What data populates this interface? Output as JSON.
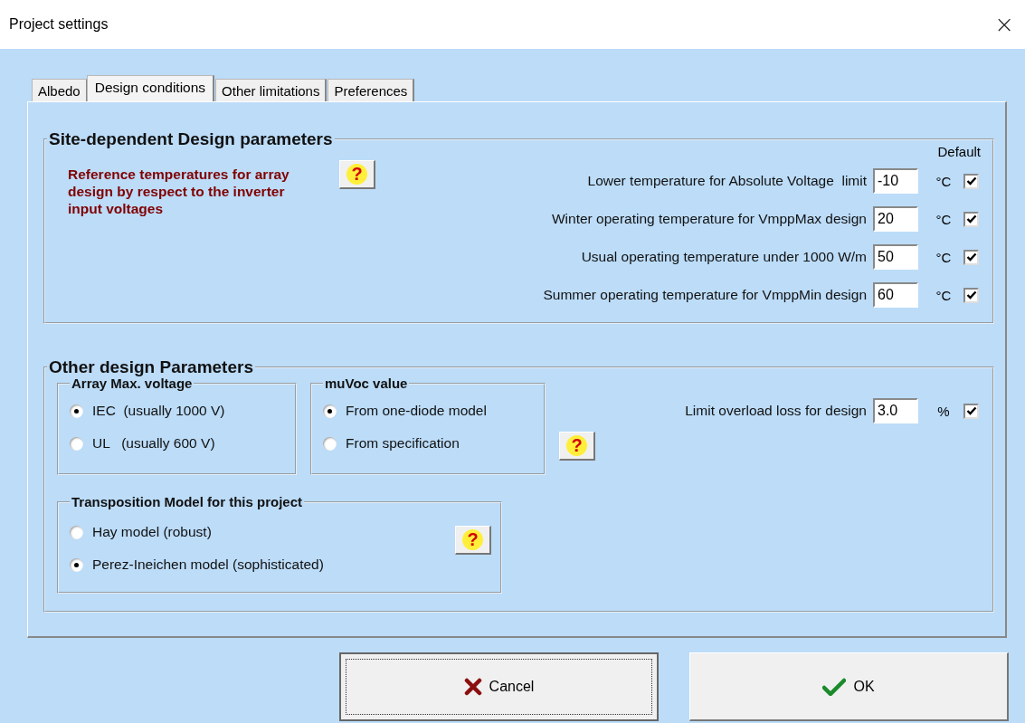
{
  "window": {
    "title": "Project settings",
    "close": "×"
  },
  "tabs": [
    {
      "label": "Albedo",
      "selected": false
    },
    {
      "label": "Design conditions",
      "selected": true
    },
    {
      "label": "Other limitations",
      "selected": false
    },
    {
      "label": "Preferences",
      "selected": false
    }
  ],
  "site_parameters": {
    "title": "Site-dependent Design parameters",
    "description": "Reference temperatures for array design by respect to the inverter input voltages",
    "help": "?",
    "default_label": "Default",
    "rows": [
      {
        "label": "Lower temperature for Absolute Voltage  limit",
        "value": "-10",
        "unit": "°C",
        "checked": true
      },
      {
        "label": "Winter operating temperature for VmppMax design",
        "value": "20",
        "unit": "°C",
        "checked": true
      },
      {
        "label": "Usual operating temperature under 1000 W/m",
        "value": "50",
        "unit": "°C",
        "checked": true
      },
      {
        "label": "Summer operating temperature for VmppMin design",
        "value": "60",
        "unit": "°C",
        "checked": true
      }
    ]
  },
  "other_parameters": {
    "title": "Other design Parameters",
    "array_voltage": {
      "title": "Array Max. voltage",
      "options": [
        {
          "label": "IEC  (usually 1000 V)",
          "selected": true
        },
        {
          "label": "UL   (usually 600 V)",
          "selected": false
        }
      ]
    },
    "muvoc": {
      "title": "muVoc value",
      "help": "?",
      "options": [
        {
          "label": "From one-diode model",
          "selected": true
        },
        {
          "label": "From specification",
          "selected": false
        }
      ]
    },
    "limit": {
      "label": "Limit overload loss for design",
      "value": "3.0",
      "unit": "%",
      "checked": true
    },
    "transposition": {
      "title": "Transposition Model for this project",
      "help": "?",
      "options": [
        {
          "label": "Hay model (robust)",
          "selected": false
        },
        {
          "label": "Perez-Ineichen model (sophisticated)",
          "selected": true
        }
      ]
    }
  },
  "buttons": [
    {
      "label": "Cancel",
      "kind": "cancel"
    },
    {
      "label": "OK",
      "kind": "ok"
    }
  ]
}
